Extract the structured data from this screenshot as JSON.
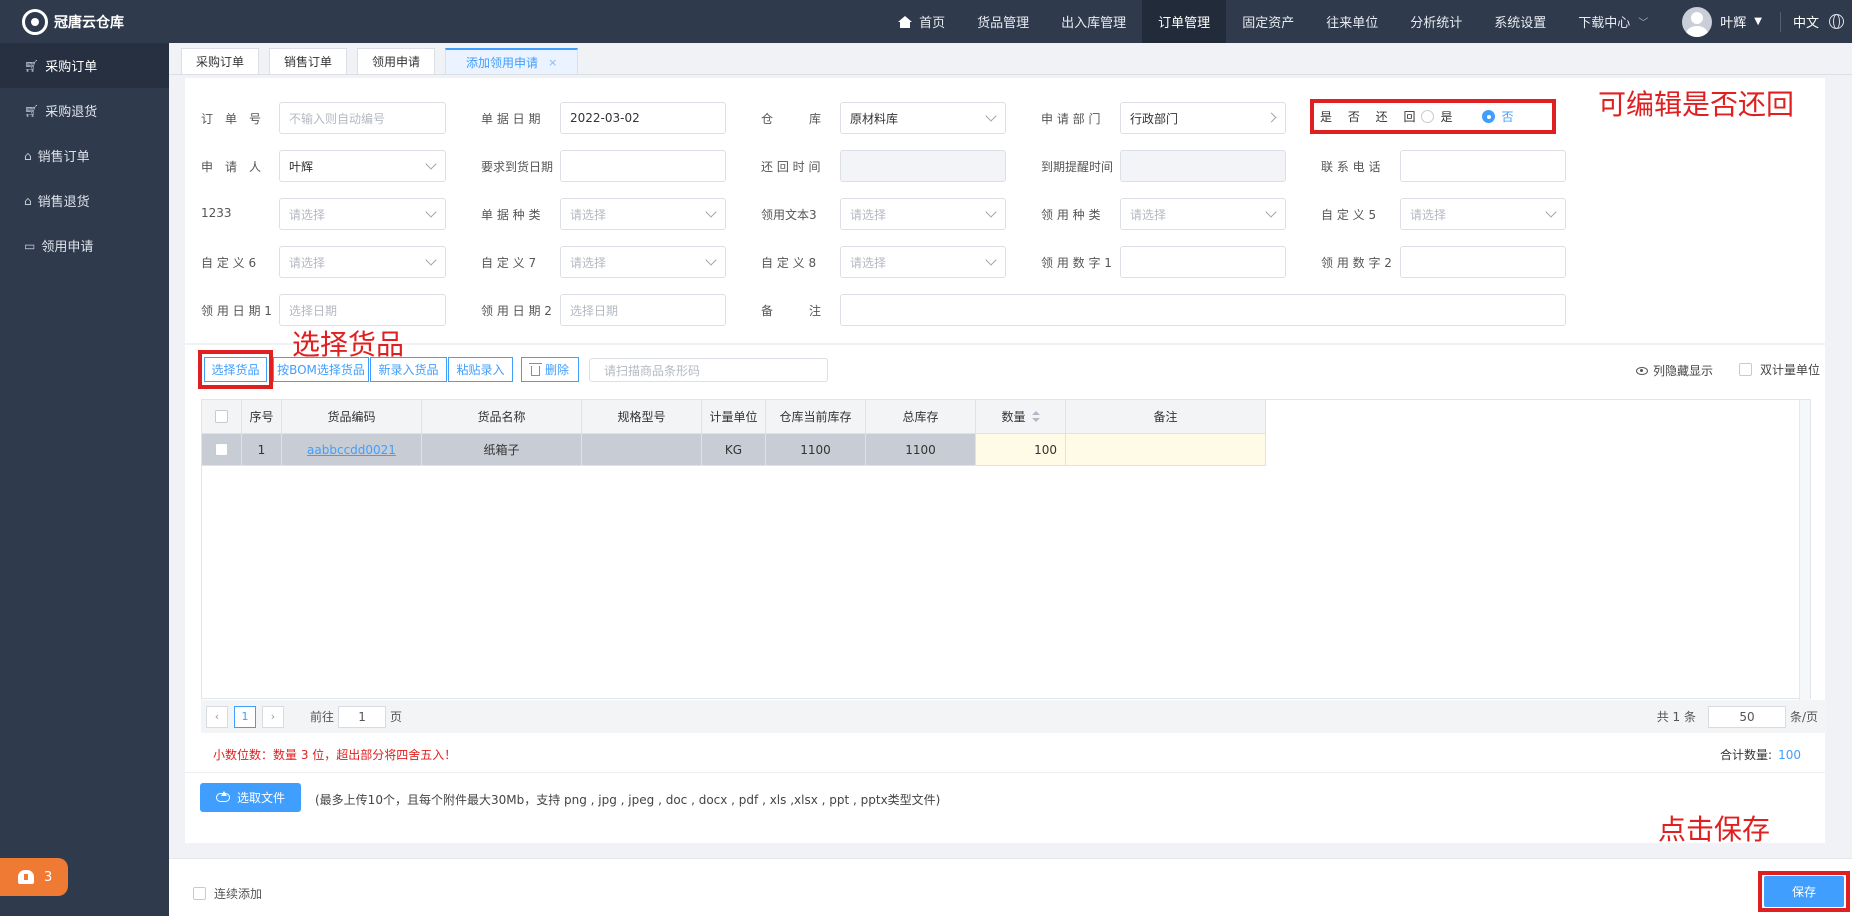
{
  "app": {
    "name": "冠唐云仓库"
  },
  "nav": {
    "items": [
      {
        "label": "首页"
      },
      {
        "label": "货品管理"
      },
      {
        "label": "出入库管理"
      },
      {
        "label": "订单管理",
        "active": true
      },
      {
        "label": "固定资产"
      },
      {
        "label": "往来单位"
      },
      {
        "label": "分析统计"
      },
      {
        "label": "系统设置"
      },
      {
        "label": "下载中心"
      }
    ],
    "user": "叶辉",
    "lang": "中文"
  },
  "sidebar": {
    "items": [
      {
        "label": "采购订单",
        "icon": "cart-icon"
      },
      {
        "label": "采购退货",
        "icon": "cart-icon"
      },
      {
        "label": "销售订单",
        "icon": "bag-icon"
      },
      {
        "label": "销售退货",
        "icon": "bag-icon"
      },
      {
        "label": "领用申请",
        "icon": "briefcase-icon"
      }
    ],
    "alert_count": "3"
  },
  "tabs": [
    {
      "label": "采购订单"
    },
    {
      "label": "销售订单"
    },
    {
      "label": "领用申请"
    },
    {
      "label": "添加领用申请",
      "active": true,
      "close": "×"
    }
  ],
  "form": {
    "order_no": {
      "label": "订　单　号",
      "placeholder": "不输入则自动编号"
    },
    "doc_date": {
      "label": "单 据 日 期",
      "value": "2022-03-02"
    },
    "warehouse": {
      "label": "仓　　　库",
      "value": "原材料库"
    },
    "dept": {
      "label": "申 请 部 门",
      "value": "行政部门"
    },
    "return": {
      "label": "是 否 还 回",
      "yes": "是",
      "no": "否",
      "selected": "否"
    },
    "applicant": {
      "label": "申　请　人",
      "value": "叶辉"
    },
    "arrival_date": {
      "label": "要求到货日期",
      "value": ""
    },
    "return_time": {
      "label": "还 回 时 间",
      "value": ""
    },
    "due_remind": {
      "label": "到期提醒时间",
      "value": ""
    },
    "phone": {
      "label": "联 系 电 话",
      "value": ""
    },
    "f1233": {
      "label": "1233",
      "placeholder": "请选择"
    },
    "doc_type": {
      "label": "单 据 种 类",
      "placeholder": "请选择"
    },
    "text3": {
      "label": "领用文本3",
      "placeholder": "请选择"
    },
    "use_type": {
      "label": "领 用 种 类",
      "placeholder": "请选择"
    },
    "custom5": {
      "label": "自 定 义 5",
      "placeholder": "请选择"
    },
    "custom6": {
      "label": "自 定 义 6",
      "placeholder": "请选择"
    },
    "custom7": {
      "label": "自 定 义 7",
      "placeholder": "请选择"
    },
    "custom8": {
      "label": "自 定 义 8",
      "placeholder": "请选择"
    },
    "num1": {
      "label": "领 用 数 字 1",
      "value": ""
    },
    "num2": {
      "label": "领 用 数 字 2",
      "value": ""
    },
    "date1": {
      "label": "领 用 日 期 1",
      "placeholder": "选择日期"
    },
    "date2": {
      "label": "领 用 日 期 2",
      "placeholder": "选择日期"
    },
    "remark": {
      "label": "备　　　注",
      "value": ""
    }
  },
  "annotations": {
    "return_editable": "可编辑是否还回",
    "select_goods": "选择货品",
    "click_save": "点击保存"
  },
  "toolbar": {
    "select_goods": "选择货品",
    "bom_select": "按BOM选择货品",
    "new_goods": "新录入货品",
    "paste": "粘贴录入",
    "delete": "删除",
    "scan_placeholder": "请扫描商品条形码",
    "col_hide": "列隐藏显示",
    "dual_unit": "双计量单位"
  },
  "table": {
    "headers": [
      "序号",
      "货品编码",
      "货品名称",
      "规格型号",
      "计量单位",
      "仓库当前库存",
      "总库存",
      "数量",
      "备注"
    ],
    "rows": [
      {
        "seq": "1",
        "code": "aabbccdd0021",
        "name": "纸箱子",
        "spec": "",
        "unit": "KG",
        "stock": "1100",
        "total": "1100",
        "qty": "100",
        "note": ""
      }
    ]
  },
  "pager": {
    "prev": "‹",
    "page": "1",
    "next": "›",
    "goto_label": "前往",
    "goto_value": "1",
    "page_suffix": "页",
    "total_text": "共 1 条",
    "page_size": "50",
    "page_size_suffix": "条/页"
  },
  "summary": {
    "warning": "小数位数：数量 3 位，超出部分将四舍五入！",
    "total_label": "合计数量:",
    "total_value": "100"
  },
  "upload": {
    "button": "选取文件",
    "hint": "(最多上传10个，且每个附件最大30Mb，支持 png , jpg , jpeg , doc , docx , pdf , xls ,xlsx , ppt , pptx类型文件)"
  },
  "footer": {
    "continue_add": "连续添加",
    "save": "保存"
  },
  "colors": {
    "primary": "#409eff",
    "sidebar": "#2f3a4c",
    "annotation": "#e02020",
    "alert": "#ef7a33"
  }
}
